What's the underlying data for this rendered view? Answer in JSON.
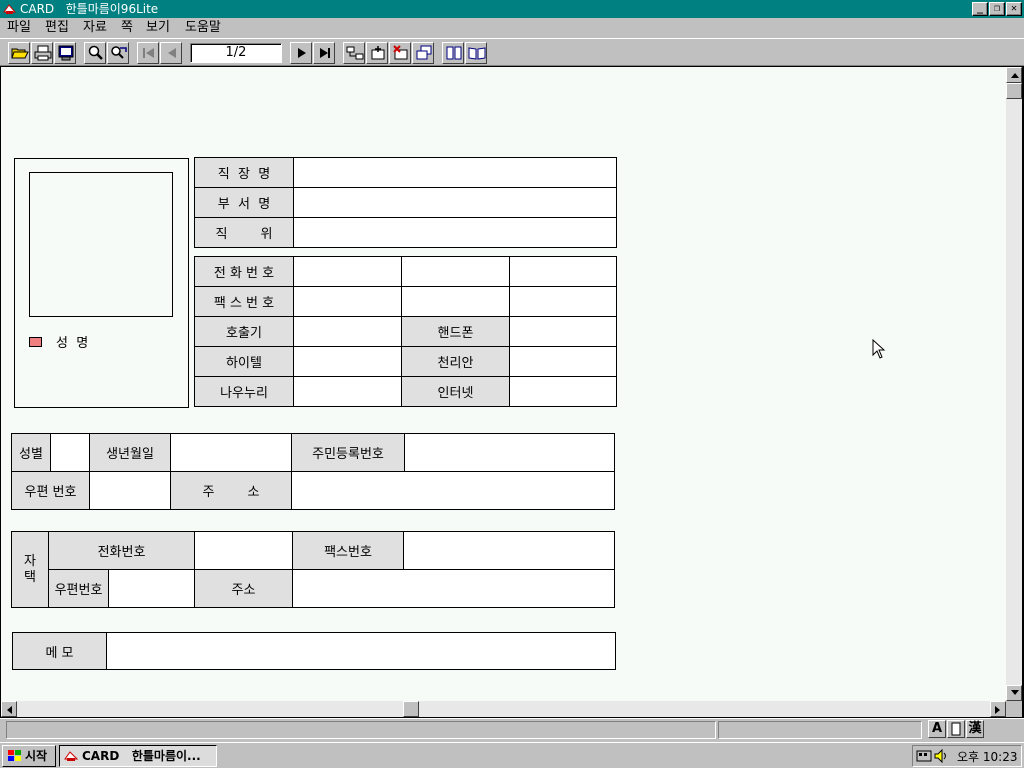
{
  "window": {
    "title": "CARD   한틀마름이96Lite",
    "controls": {
      "minimize": "_",
      "restore": "❐",
      "close": "✕"
    }
  },
  "menu": [
    "파일",
    "편집",
    "자료",
    "쪽",
    "보기",
    "도움말"
  ],
  "toolbar": {
    "page_indicator": "1/2"
  },
  "card": {
    "name_label": "성  명",
    "workplace": {
      "company_label": "직  장  명",
      "department_label": "부  서  명",
      "position_label": "직        위"
    },
    "contact": {
      "phone_label": "전 화 번 호",
      "fax_label": "팩 스 번 호",
      "pager_label": "호출기",
      "mobile_label": "핸드폰",
      "hitel_label": "하이텔",
      "chollian_label": "천리안",
      "nownuri_label": "나우누리",
      "internet_label": "인터넷"
    },
    "personal": {
      "gender_label": "성별",
      "birthdate_label": "생년월일",
      "resident_id_label": "주민등록번호",
      "zipcode_label": "우편 번호",
      "address_label": "주        소"
    },
    "home": {
      "section_label": "자\n택",
      "phone_label": "전화번호",
      "fax_label": "팩스번호",
      "zipcode_label": "우편번호",
      "address_label": "주소"
    },
    "memo_label": "메 모"
  },
  "statusbar": {
    "ime": [
      "A",
      "",
      "漢"
    ]
  },
  "taskbar": {
    "start_label": "시작",
    "task_label": "CARD   한틀마름이...",
    "clock": "오후 10:23"
  },
  "colors": {
    "titlebar": "#008080",
    "label_fill": "#e0e0e0",
    "page_bg": "#f7fbf7",
    "name_marker": "#f08080"
  }
}
